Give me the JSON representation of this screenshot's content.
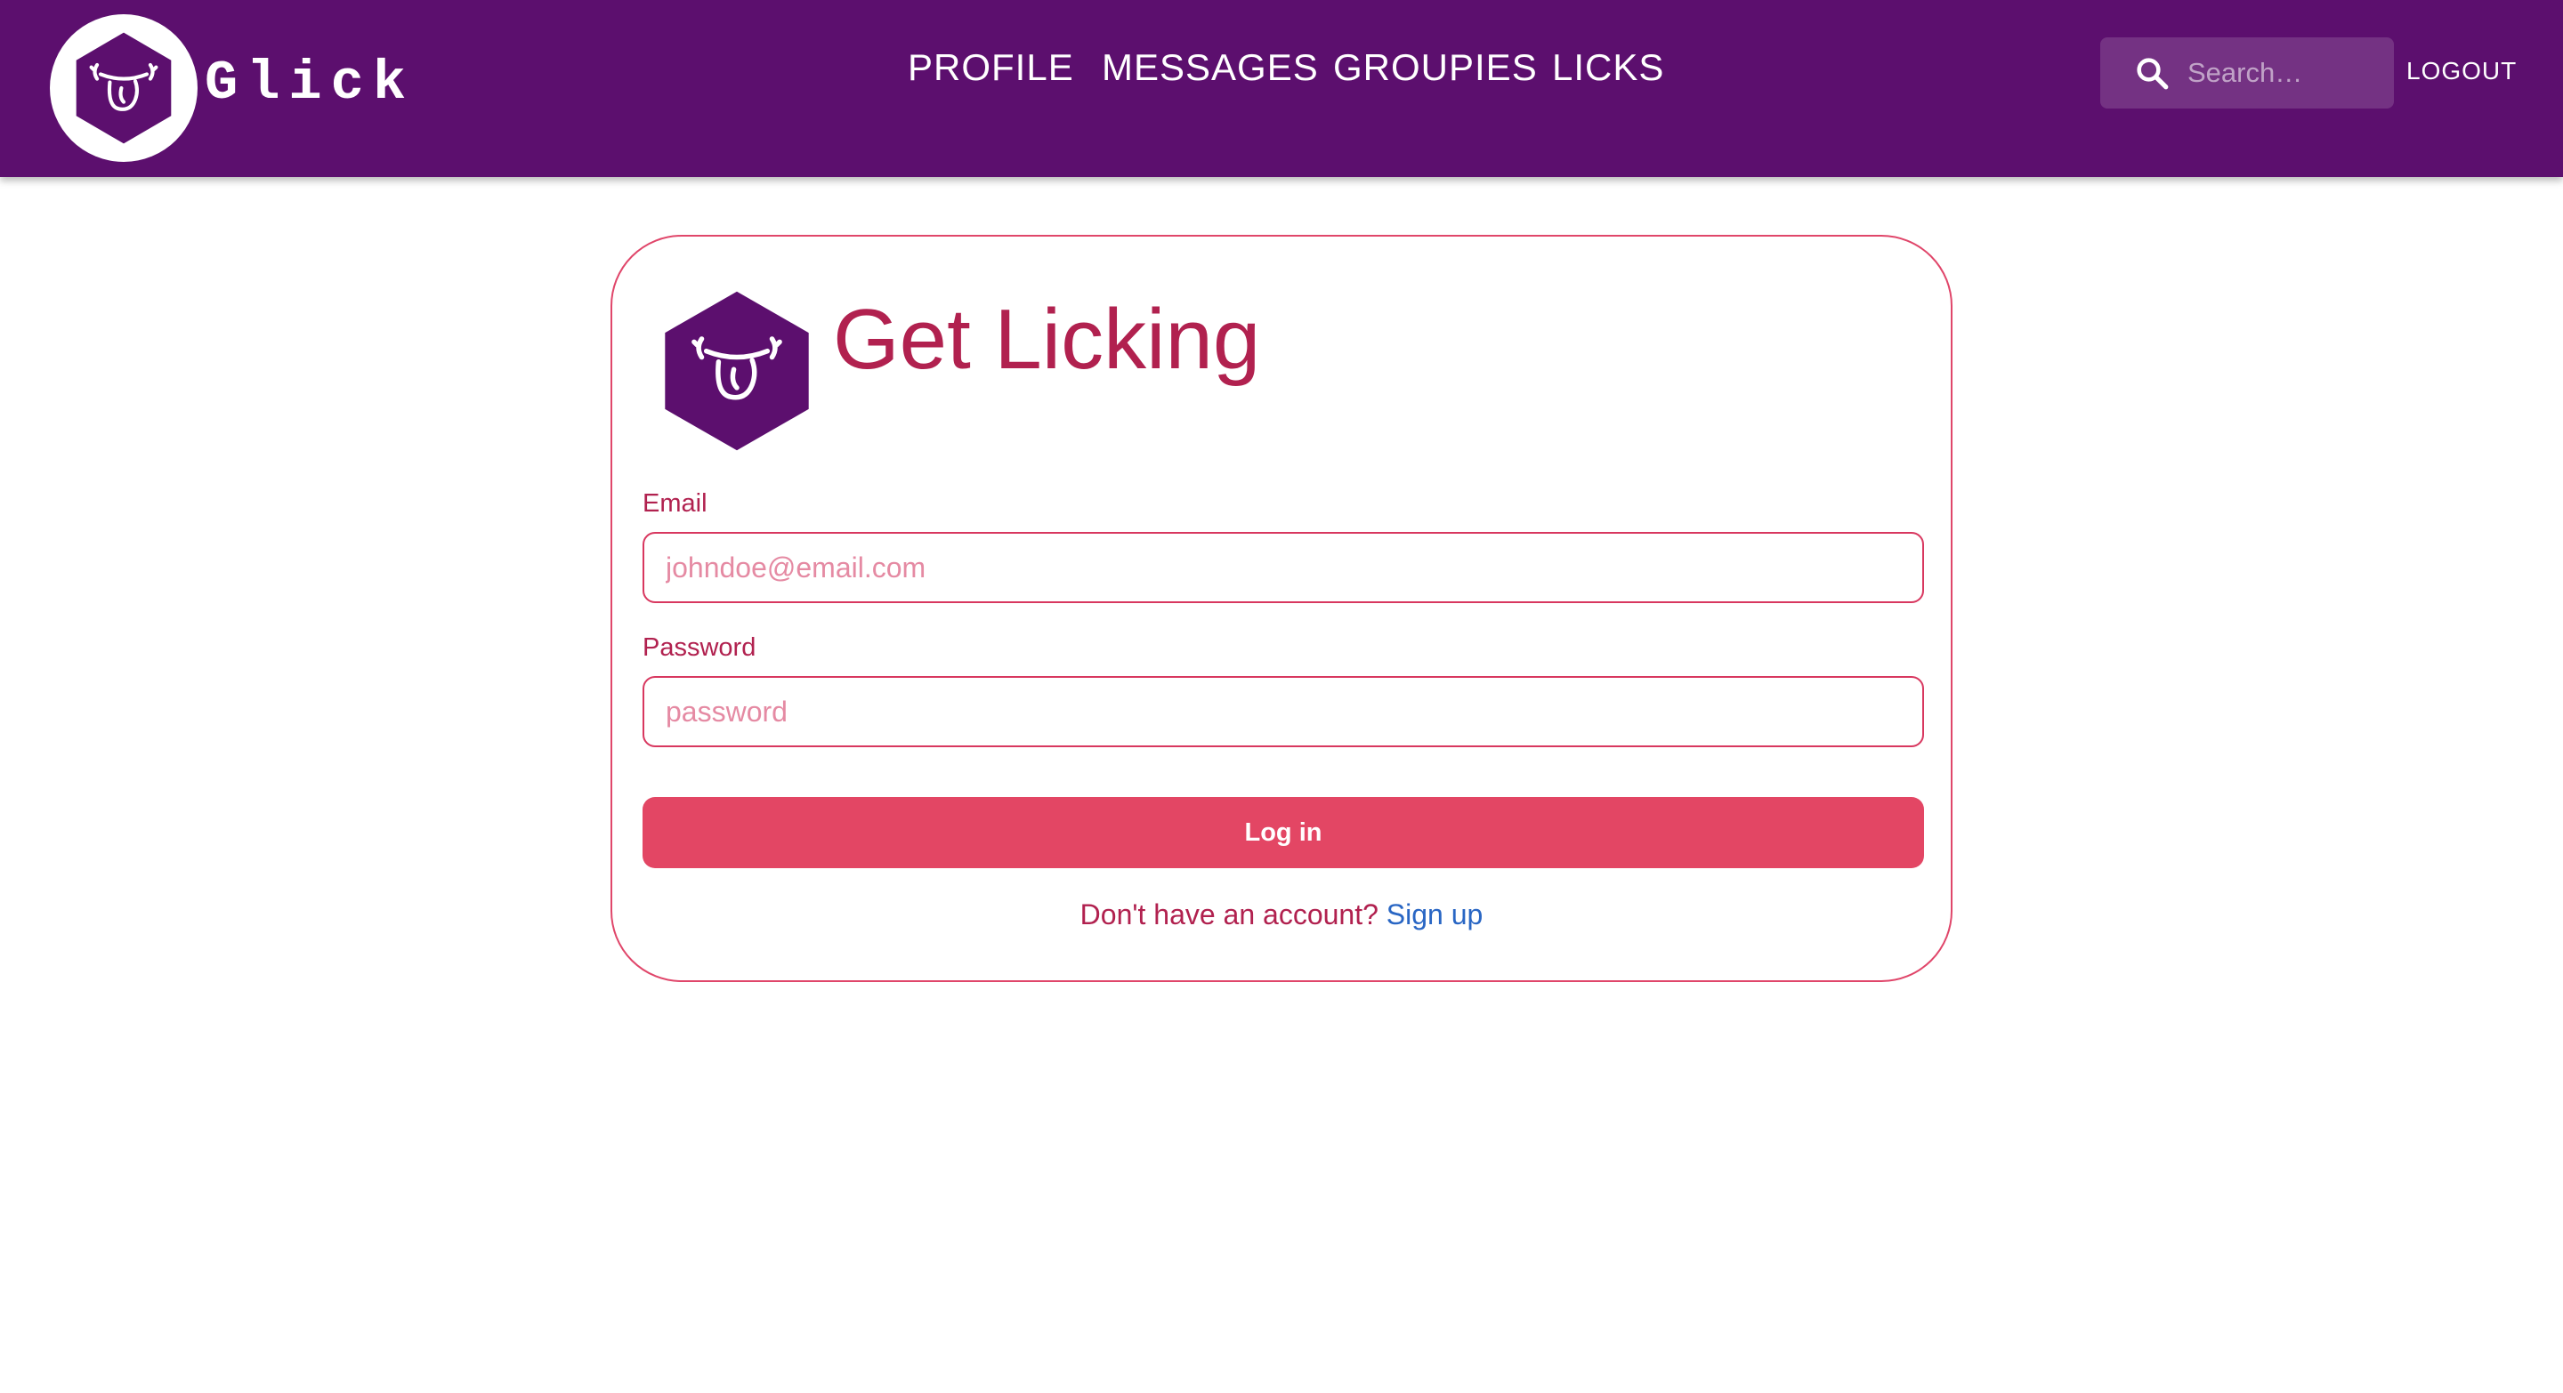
{
  "app": {
    "brand_name": "Glick",
    "logo_icon": "tongue-face-hexagon-icon"
  },
  "nav": {
    "items": [
      {
        "label": "PROFILE"
      },
      {
        "label": "MESSAGES"
      },
      {
        "label": "GROUPIES"
      },
      {
        "label": "LICKS"
      }
    ]
  },
  "search": {
    "placeholder": "Search…",
    "value": "",
    "icon": "search-icon"
  },
  "header_actions": {
    "logout_label": "LOGOUT"
  },
  "login": {
    "title": "Get Licking",
    "email_label": "Email",
    "email_placeholder": "johndoe@email.com",
    "email_value": "",
    "password_label": "Password",
    "password_placeholder": "password",
    "password_value": "",
    "submit_label": "Log in",
    "signup_prompt": "Don't have an account?",
    "signup_link": "Sign up"
  },
  "colors": {
    "appbar": "#5c0f6e",
    "accent_text": "#b1214f",
    "button": "#e34664",
    "border": "#e0466a",
    "link": "#2966c4"
  }
}
